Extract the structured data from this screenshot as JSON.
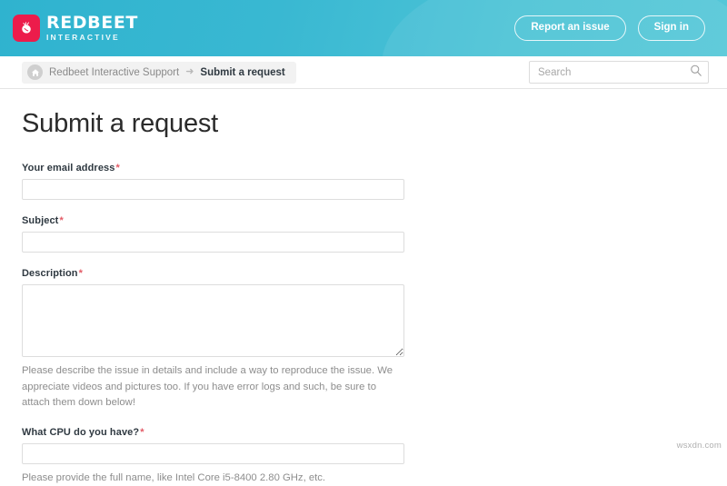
{
  "header": {
    "logo": {
      "title": "REDBEET",
      "subtitle": "INTERACTIVE",
      "icon": "beet-icon",
      "mark_color": "#ec1c4b"
    },
    "report_issue_label": "Report an issue",
    "sign_in_label": "Sign in",
    "background_color": "#39b8d2"
  },
  "subnav": {
    "home_icon": "home-icon",
    "breadcrumb_root": "Redbeet Interactive Support",
    "breadcrumb_separator": "➜",
    "breadcrumb_current": "Submit a request",
    "search": {
      "placeholder": "Search",
      "value": "",
      "icon": "search-icon"
    }
  },
  "main": {
    "page_title": "Submit a request",
    "required_marker": "*",
    "fields": [
      {
        "name": "email",
        "label": "Your email address",
        "required": true,
        "value": "",
        "type": "text",
        "help": ""
      },
      {
        "name": "subject",
        "label": "Subject",
        "required": true,
        "value": "",
        "type": "text",
        "help": ""
      },
      {
        "name": "description",
        "label": "Description",
        "required": true,
        "value": "",
        "type": "textarea",
        "help": "Please describe the issue in details and include a way to reproduce the issue. We appreciate videos and pictures too. If you have error logs and such, be sure to attach them down below!"
      },
      {
        "name": "cpu",
        "label": "What CPU do you have?",
        "required": true,
        "value": "",
        "type": "text",
        "help": "Please provide the full name, like Intel Core i5-8400 2.80 GHz, etc."
      }
    ]
  },
  "watermark": "wsxdn.com"
}
